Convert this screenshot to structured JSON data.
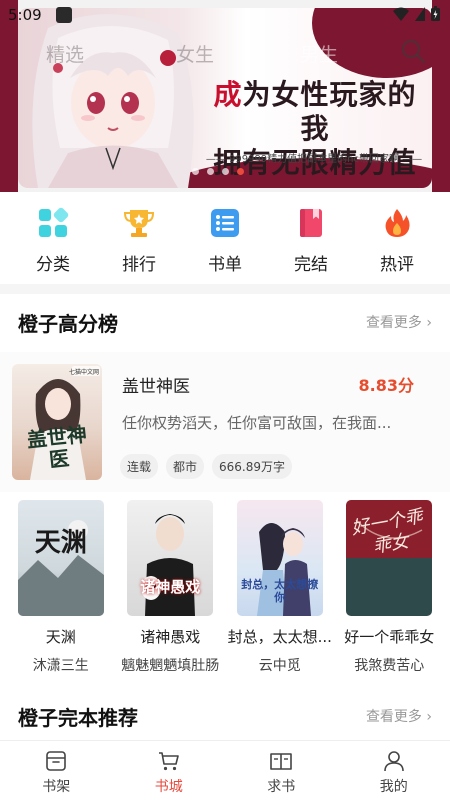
{
  "status_bar": {
    "time": "5:09"
  },
  "top_tabs": [
    "精选",
    "女生",
    "男生"
  ],
  "banner": {
    "headline_line1_red": "成",
    "headline_line1_rest": "为女性玩家的我",
    "headline_line2": "拥有无限精力值",
    "tagline": "—— 999999精力值把副本里的nc带回家啊 ——",
    "active_dot": 3
  },
  "categories": [
    {
      "label": "分类",
      "icon": "category-icon"
    },
    {
      "label": "排行",
      "icon": "trophy-icon"
    },
    {
      "label": "书单",
      "icon": "list-icon"
    },
    {
      "label": "完结",
      "icon": "book-icon"
    },
    {
      "label": "热评",
      "icon": "flame-icon"
    }
  ],
  "section_ranking": {
    "title": "橙子高分榜",
    "more": "查看更多"
  },
  "featured_book": {
    "title": "盖世神医",
    "score": "8.83分",
    "description": "任你权势滔天，任你富可敌国，在我面...",
    "tags": [
      "连载",
      "都市",
      "666.89万字"
    ],
    "cover_text": "盖世神医",
    "cover_badge": "七猫中文网"
  },
  "books": [
    {
      "title": "天渊",
      "author": "沐潇三生",
      "cover_text": "天渊"
    },
    {
      "title": "诸神愚戏",
      "author": "魑魅魍魉填肚肠",
      "cover_text": "诸神愚戏"
    },
    {
      "title": "封总，太太想...",
      "author": "云中觅",
      "cover_text": "封总，太太想撩你"
    },
    {
      "title": "好一个乖乖女",
      "author": "我煞费苦心",
      "cover_text": "好一个乖乖女"
    }
  ],
  "section_complete": {
    "title": "橙子完本推荐",
    "more": "查看更多"
  },
  "bottom_nav": [
    {
      "label": "书架",
      "icon": "bookshelf-icon"
    },
    {
      "label": "书城",
      "icon": "cart-icon",
      "active": true
    },
    {
      "label": "求书",
      "icon": "open-book-icon"
    },
    {
      "label": "我的",
      "icon": "profile-icon"
    }
  ],
  "colors": {
    "accent": "#e84a3c",
    "score": "#e54d2e",
    "banner_maroon": "#7d1630"
  }
}
